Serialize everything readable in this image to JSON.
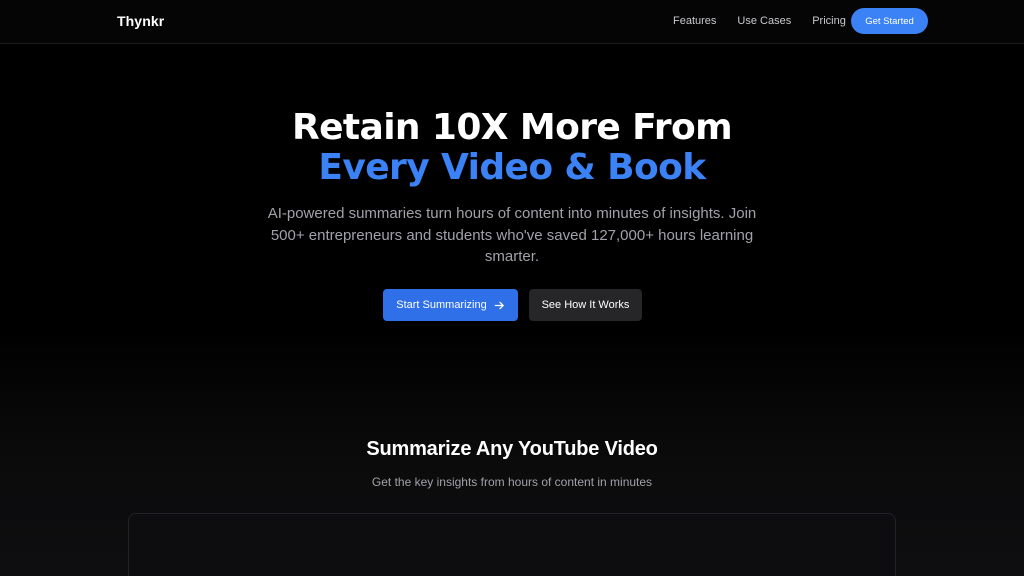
{
  "nav": {
    "brand": "Thynkr",
    "links": [
      "Features",
      "Use Cases",
      "Pricing"
    ],
    "cta": "Get Started"
  },
  "hero": {
    "title_line1": "Retain 10X More From",
    "title_line2": "Every Video & Book",
    "subtitle": "AI-powered summaries turn hours of content into minutes of insights. Join 500+ entrepreneurs and students who've saved 127,000+ hours learning smarter.",
    "primary_button": "Start Summarizing",
    "secondary_button": "See How It Works"
  },
  "section": {
    "title": "Summarize Any YouTube Video",
    "subtitle": "Get the key insights from hours of content in minutes"
  },
  "colors": {
    "background": "#000000",
    "accent": "#3b82f6",
    "muted_text": "#a1a1aa",
    "secondary_button": "#262629"
  },
  "icons": {
    "primary_button_icon": "arrow-right-icon"
  }
}
